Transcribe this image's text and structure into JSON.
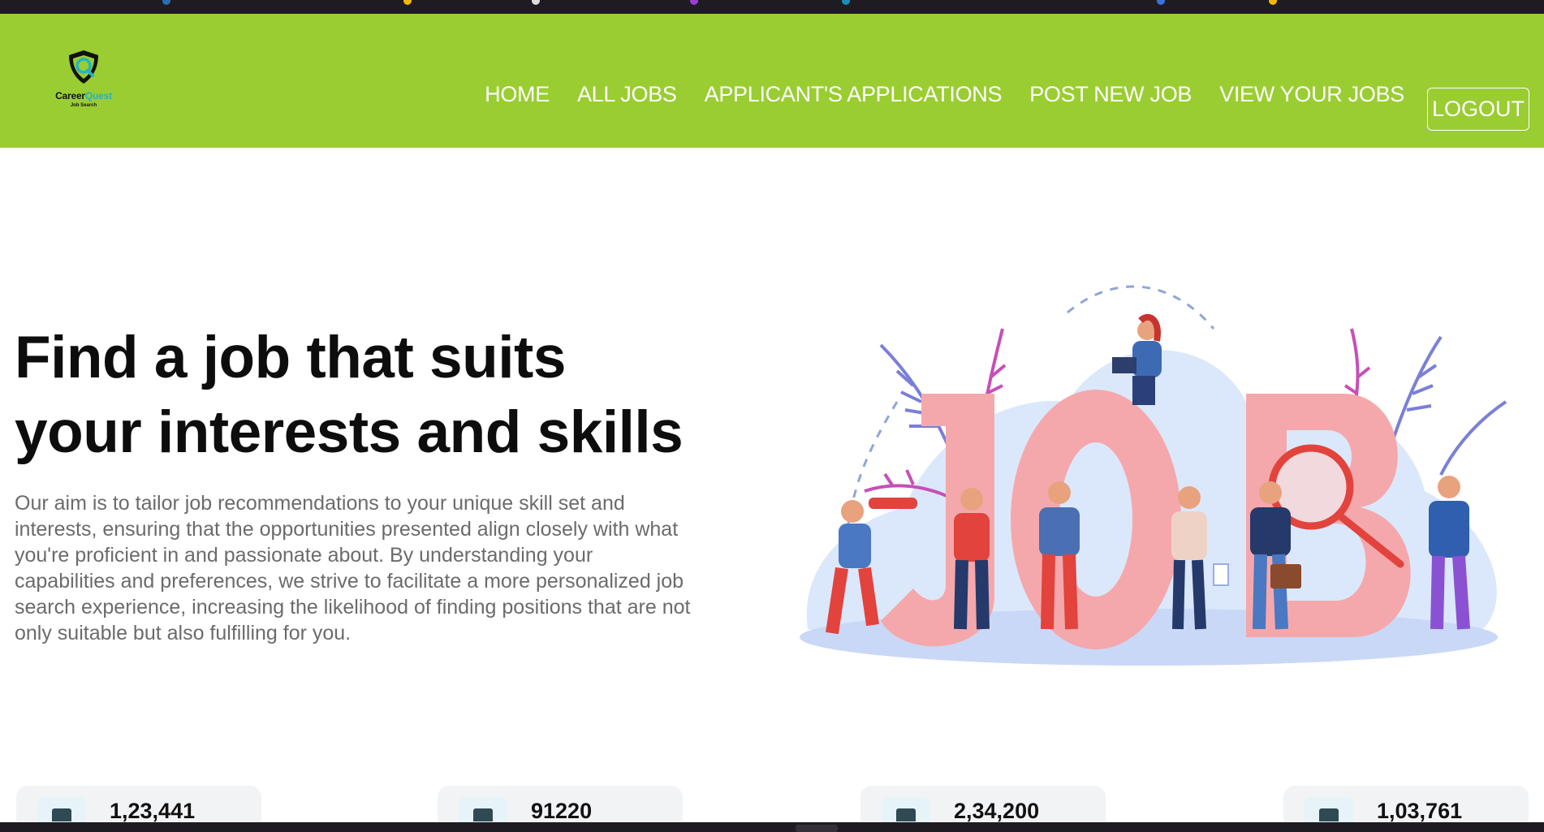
{
  "colors": {
    "navbar_bg": "#9acd32",
    "nav_text": "#ffffff",
    "heading": "#0d0d0d",
    "body_text": "#6b6b6b",
    "stat_card_bg": "#f2f3f5",
    "brand_accent": "#1fb5c4"
  },
  "brand": {
    "name_part1": "Career",
    "name_part2": "Quest",
    "tagline": "Job Search",
    "icon": "shield-search-icon"
  },
  "nav": {
    "links": [
      {
        "label": "HOME"
      },
      {
        "label": "ALL JOBS"
      },
      {
        "label": "APPLICANT'S APPLICATIONS"
      },
      {
        "label": "POST NEW JOB"
      },
      {
        "label": "VIEW YOUR JOBS"
      }
    ],
    "logout_label": "LOGOUT"
  },
  "hero": {
    "title_line1": "Find a job that suits",
    "title_line2": "your interests and skills",
    "description": "Our aim is to tailor job recommendations to your unique skill set and interests, ensuring that the opportunities presented align closely with what you're proficient in and passionate about. By understanding your capabilities and preferences, we strive to facilitate a more personalized job search experience, increasing the likelihood of finding positions that are not only suitable but also fulfilling for you.",
    "illustration": "job-people-illustration"
  },
  "stats": [
    {
      "value": "1,23,441",
      "icon": "briefcase-icon"
    },
    {
      "value": "91220",
      "icon": "building-icon"
    },
    {
      "value": "2,34,200",
      "icon": "users-icon"
    },
    {
      "value": "1,03,761",
      "icon": "person-icon"
    }
  ]
}
